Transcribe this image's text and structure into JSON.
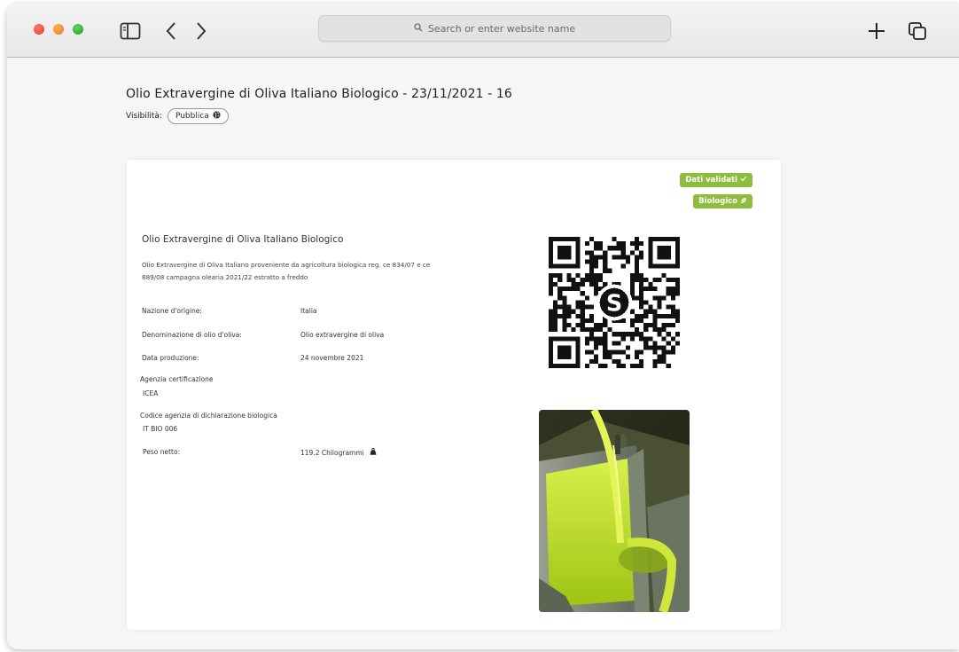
{
  "browser": {
    "url_placeholder": "Search or enter website name",
    "icons": [
      "sidebar-icon",
      "chevron-left-icon",
      "chevron-right-icon",
      "plus-icon",
      "tabs-icon",
      "search-icon"
    ]
  },
  "page": {
    "title": "Olio Extravergine di Oliva Italiano Biologico - 23/11/2021 - 16",
    "visibility_label": "Visibilità:",
    "visibility_value": "Pubblica"
  },
  "badges": {
    "validated": "Dati validati",
    "organic": "Biologico"
  },
  "product": {
    "name": "Olio Extravergine di Oliva Italiano Biologico",
    "description": "Olio Extravergine di Oliva Italiano proveniente da agricoltura biologica reg. ce 834/07 e ce 889/08 campagna olearia 2021/22 estratto a freddo",
    "fields": [
      {
        "label": "Nazione d'origine:",
        "value": "Italia"
      },
      {
        "label": "Denominazione di olio d'oliva:",
        "value": "Olio extravergine di oliva"
      },
      {
        "label": "Data produzione:",
        "value": "24 novembre 2021"
      }
    ],
    "cert_agency_label": "Agenzia certificazione",
    "cert_agency_value": "ICEA",
    "bio_code_label": "Codice agenzia di dichiarazione biologica",
    "bio_code_value": "IT BIO 006",
    "net_weight_label": "Peso netto:",
    "net_weight_value": "119.2 Chilogrammi"
  },
  "colors": {
    "badge": "#8dbd3c",
    "oil": "#b7e51e"
  }
}
